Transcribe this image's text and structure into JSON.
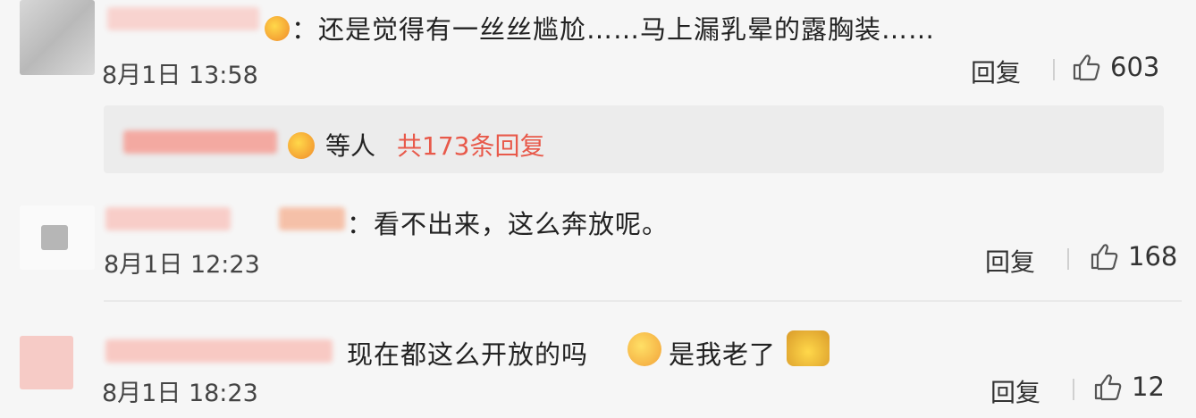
{
  "comments": [
    {
      "text": "：还是觉得有一丝丝尴尬……马上漏乳晕的露胸装……",
      "time": "8月1日 13:58",
      "reply_label": "回复",
      "likes": "603"
    },
    {
      "text": "：看不出来，这么奔放呢。",
      "time": "8月1日 12:23",
      "reply_label": "回复",
      "likes": "168"
    },
    {
      "text_a": "现在都这么开放的吗",
      "text_b": "是我老了",
      "time": "8月1日 18:23",
      "reply_label": "回复",
      "likes": "12"
    }
  ],
  "thread": {
    "prefix": "等人",
    "count_label": "共173条回复"
  },
  "colors": {
    "accent": "#e8594a",
    "name_blur": "#f3b4ae",
    "background": "#f6f6f6"
  },
  "icons": [
    "thumbs-up-icon",
    "emoji-icon"
  ]
}
